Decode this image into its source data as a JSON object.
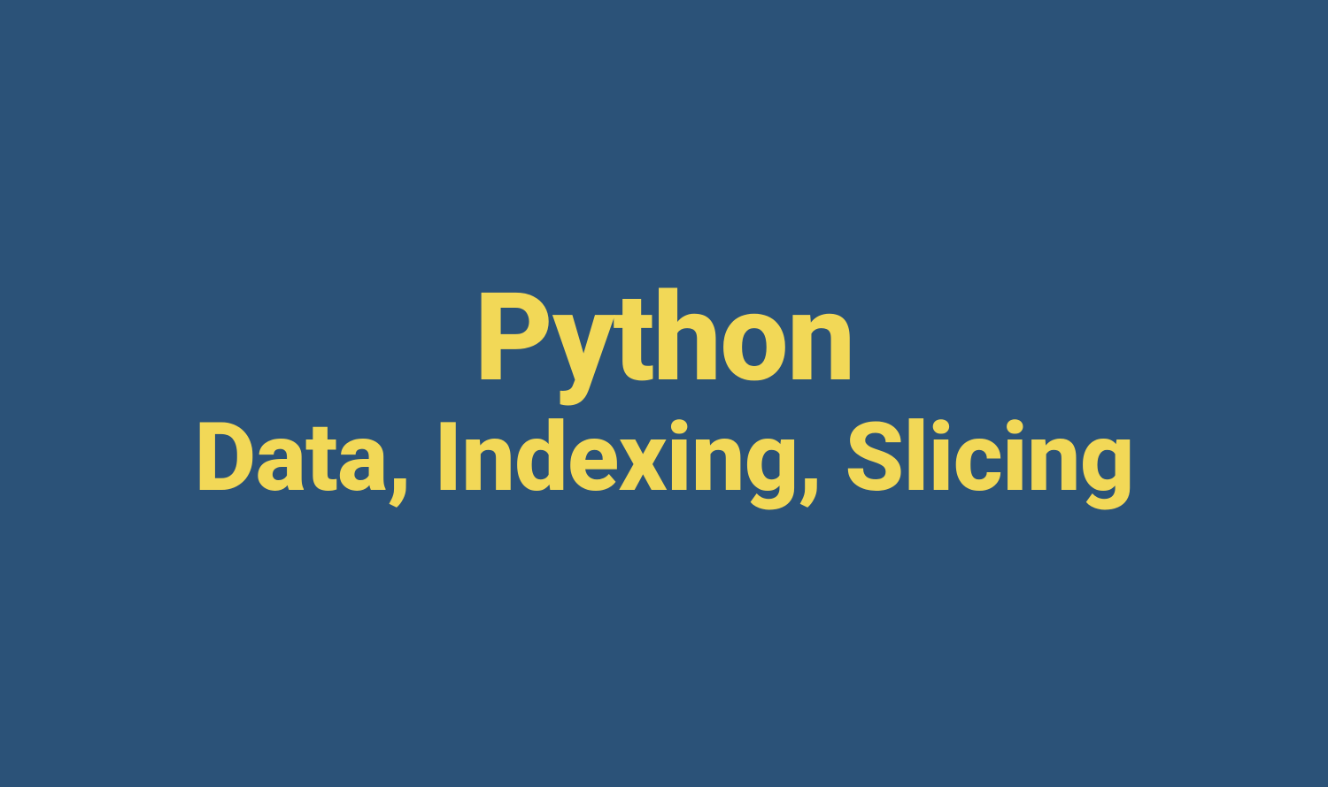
{
  "title": "Python",
  "subtitle": "Data, Indexing, Slicing"
}
